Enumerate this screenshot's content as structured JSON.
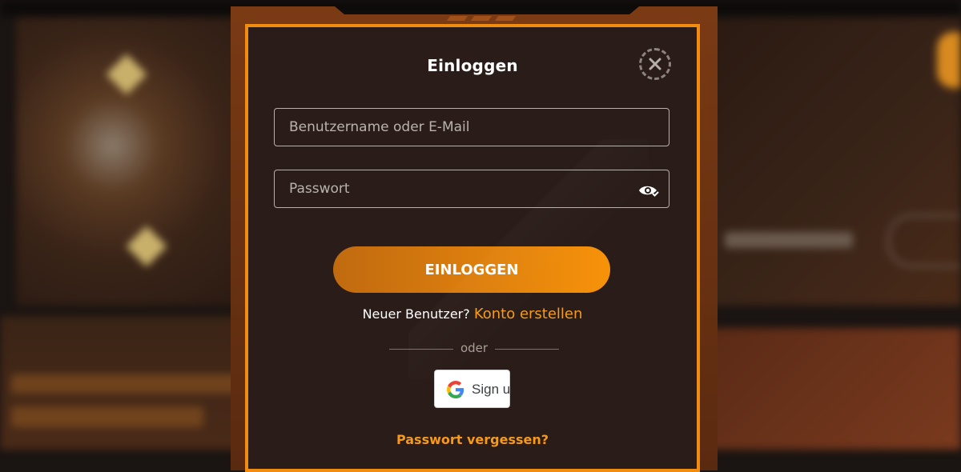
{
  "modal": {
    "title": "Einloggen",
    "close_icon": "close-circle-icon",
    "username": {
      "placeholder": "Benutzername oder E-Mail",
      "value": ""
    },
    "password": {
      "placeholder": "Passwort",
      "value": "",
      "toggle_icon": "eye-icon"
    },
    "login_button": "EINLOGGEN",
    "new_user_text": "Neuer Benutzer?",
    "create_account_link": "Konto erstellen",
    "divider_text": "oder",
    "google_button": {
      "icon": "google-icon",
      "label": "Sign u"
    },
    "forgot_password": "Passwort vergessen?"
  },
  "colors": {
    "accent": "#f7920a",
    "modal_bg": "#2a1d19",
    "frame": "#f08c10"
  }
}
